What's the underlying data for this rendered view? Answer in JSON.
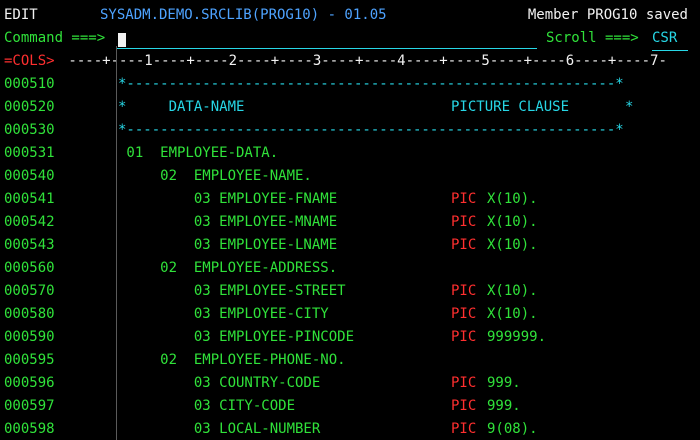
{
  "header": {
    "mode": "EDIT",
    "dataset": "SYSADM.DEMO.SRCLIB(PROG10) - 01.05",
    "message": "Member PROG10 saved"
  },
  "command": {
    "label": "Command ===>",
    "value": "",
    "scroll_label": "Scroll ===>",
    "scroll_value": "CSR"
  },
  "ruler": {
    "tag": "=COLS>",
    "scale": " ----+----1----+----2----+----3----+----4----+----5----+----6----+----7-"
  },
  "lines": [
    {
      "num": "000510",
      "code": "*----------------------------------------------------------*",
      "pic": "",
      "val": "",
      "kind": "comment"
    },
    {
      "num": "000520",
      "code": "*     DATA-NAME",
      "pic": "",
      "val": "",
      "kind": "header",
      "header_pic": "PICTURE CLAUSE",
      "end": "*"
    },
    {
      "num": "000530",
      "code": "*----------------------------------------------------------*",
      "pic": "",
      "val": "",
      "kind": "comment"
    },
    {
      "num": "000531",
      "code": " 01  EMPLOYEE-DATA.",
      "pic": "",
      "val": "",
      "kind": "code"
    },
    {
      "num": "000540",
      "code": "     02  EMPLOYEE-NAME.",
      "pic": "",
      "val": "",
      "kind": "code"
    },
    {
      "num": "000541",
      "code": "         03 EMPLOYEE-FNAME",
      "pic": "PIC",
      "val": "X(10).",
      "kind": "code"
    },
    {
      "num": "000542",
      "code": "         03 EMPLOYEE-MNAME",
      "pic": "PIC",
      "val": "X(10).",
      "kind": "code"
    },
    {
      "num": "000543",
      "code": "         03 EMPLOYEE-LNAME",
      "pic": "PIC",
      "val": "X(10).",
      "kind": "code"
    },
    {
      "num": "000560",
      "code": "     02  EMPLOYEE-ADDRESS.",
      "pic": "",
      "val": "",
      "kind": "code"
    },
    {
      "num": "000570",
      "code": "         03 EMPLOYEE-STREET",
      "pic": "PIC",
      "val": "X(10).",
      "kind": "code"
    },
    {
      "num": "000580",
      "code": "         03 EMPLOYEE-CITY",
      "pic": "PIC",
      "val": "X(10).",
      "kind": "code"
    },
    {
      "num": "000590",
      "code": "         03 EMPLOYEE-PINCODE",
      "pic": "PIC",
      "val": "999999.",
      "kind": "code"
    },
    {
      "num": "000595",
      "code": "     02  EMPLOYEE-PHONE-NO.",
      "pic": "",
      "val": "",
      "kind": "code"
    },
    {
      "num": "000596",
      "code": "         03 COUNTRY-CODE",
      "pic": "PIC",
      "val": "999.",
      "kind": "code"
    },
    {
      "num": "000597",
      "code": "         03 CITY-CODE",
      "pic": "PIC",
      "val": "999.",
      "kind": "code"
    },
    {
      "num": "000598",
      "code": "         03 LOCAL-NUMBER",
      "pic": "PIC",
      "val": "9(08).",
      "kind": "code"
    }
  ],
  "colors": {
    "background": "#000000",
    "text_white": "#f2f2f2",
    "line_numbers": "#30e23a",
    "comments": "#27d7e6",
    "pic_keyword": "#ff2f2f"
  }
}
